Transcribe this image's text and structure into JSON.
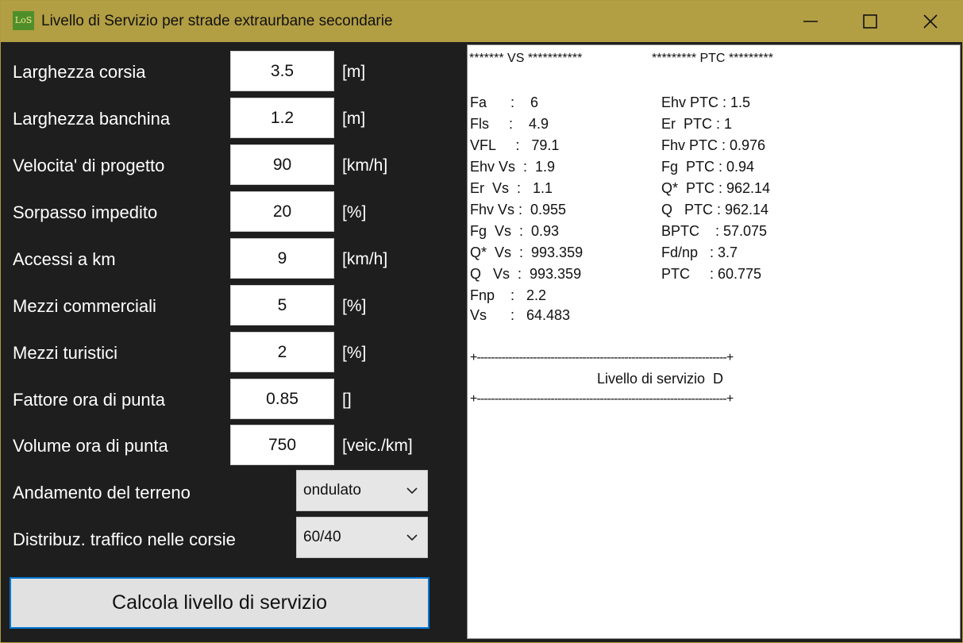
{
  "window": {
    "icon_text": "LoS",
    "title": "Livello di Servizio per strade extraurbane secondarie"
  },
  "form": {
    "fields": [
      {
        "label": "Larghezza corsia",
        "value": "3.5",
        "unit": "[m]"
      },
      {
        "label": "Larghezza banchina",
        "value": "1.2",
        "unit": "[m]"
      },
      {
        "label": "Velocita' di progetto",
        "value": "90",
        "unit": "[km/h]"
      },
      {
        "label": "Sorpasso impedito",
        "value": "20",
        "unit": "[%]"
      },
      {
        "label": "Accessi a km",
        "value": "9",
        "unit": "[km/h]"
      },
      {
        "label": "Mezzi commerciali",
        "value": "5",
        "unit": "[%]"
      },
      {
        "label": "Mezzi turistici",
        "value": "2",
        "unit": "[%]"
      },
      {
        "label": "Fattore ora di punta",
        "value": "0.85",
        "unit": "[]"
      },
      {
        "label": "Volume ora di punta",
        "value": "750",
        "unit": "[veic./km]"
      }
    ],
    "selects": [
      {
        "label": "Andamento del terreno",
        "value": "ondulato"
      },
      {
        "label": "Distribuz. traffico nelle corsie",
        "value": "60/40"
      }
    ],
    "calc_button": "Calcola livello di servizio"
  },
  "output": {
    "vs_header": "******* VS ***********",
    "ptc_header": "********* PTC *********",
    "vs_lines": [
      "Fa      :    6",
      "Fls     :    4.9",
      "VFL     :   79.1",
      "Ehv Vs  :  1.9",
      "Er  Vs  :   1.1",
      "Fhv Vs :  0.955",
      "Fg  Vs  :  0.93",
      "Q*  Vs  :  993.359",
      "Q   Vs  :  993.359",
      "Fnp    :   2.2",
      "Vs      :   64.483"
    ],
    "ptc_lines": [
      "Ehv PTC : 1.5",
      "Er  PTC : 1",
      "Fhv PTC : 0.976",
      "Fg  PTC : 0.94",
      "Q*  PTC : 962.14",
      "Q   PTC : 962.14",
      "BPTC    : 57.075",
      "Fd/np   : 3.7",
      "PTC     : 60.775"
    ],
    "separator": "+-----------------------------------------------------------------------+",
    "level_text": "Livello di servizio  D"
  }
}
